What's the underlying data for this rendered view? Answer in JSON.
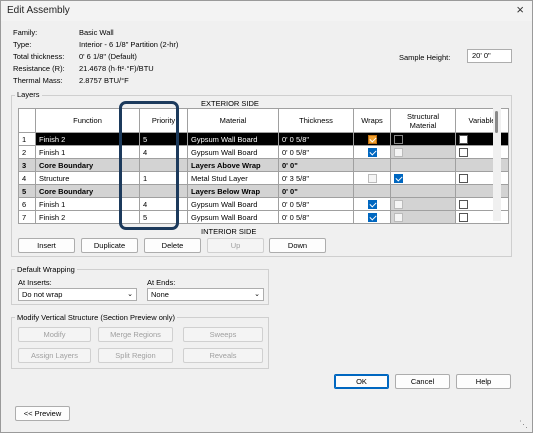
{
  "window": {
    "title": "Edit Assembly",
    "close_icon": "×"
  },
  "info": {
    "family_label": "Family:",
    "family_value": "Basic Wall",
    "type_label": "Type:",
    "type_value": "Interior - 6 1/8\" Partition (2-hr)",
    "thickness_label": "Total thickness:",
    "thickness_value": "0'  6 1/8\" (Default)",
    "resistance_label": "Resistance (R):",
    "resistance_value": "21.4678 (h·ft²·°F)/BTU",
    "mass_label": "Thermal Mass:",
    "mass_value": "2.8757 BTU/°F",
    "sample_height_label": "Sample Height:",
    "sample_height_value": "20'  0\""
  },
  "layers": {
    "group_title": "Layers",
    "exterior_label": "EXTERIOR SIDE",
    "interior_label": "INTERIOR SIDE",
    "columns": [
      "",
      "Function",
      "Priority",
      "Material",
      "Thickness",
      "Wraps",
      "Structural Material",
      "Variable"
    ],
    "rows": [
      {
        "num": "1",
        "function": "Finish 2",
        "priority": "5",
        "material": "Gypsum Wall Board",
        "thickness": "0'  0 5/8\""
      },
      {
        "num": "2",
        "function": "Finish 1",
        "priority": "4",
        "material": "Gypsum Wall Board",
        "thickness": "0'  0 5/8\""
      },
      {
        "num": "3",
        "function": "Core Boundary",
        "priority": "",
        "material": "Layers Above Wrap",
        "thickness": "0'  0\""
      },
      {
        "num": "4",
        "function": "Structure",
        "priority": "1",
        "material": "Metal Stud Layer",
        "thickness": "0'  3 5/8\""
      },
      {
        "num": "5",
        "function": "Core Boundary",
        "priority": "",
        "material": "Layers Below Wrap",
        "thickness": "0'  0\""
      },
      {
        "num": "6",
        "function": "Finish 1",
        "priority": "4",
        "material": "Gypsum Wall Board",
        "thickness": "0'  0 5/8\""
      },
      {
        "num": "7",
        "function": "Finish 2",
        "priority": "5",
        "material": "Gypsum Wall Board",
        "thickness": "0'  0 5/8\""
      }
    ]
  },
  "layer_buttons": {
    "insert": "Insert",
    "duplicate": "Duplicate",
    "delete": "Delete",
    "up": "Up",
    "down": "Down"
  },
  "wrapping": {
    "group_title": "Default Wrapping",
    "inserts_label": "At Inserts:",
    "inserts_value": "Do not wrap",
    "ends_label": "At Ends:",
    "ends_value": "None"
  },
  "vertical": {
    "group_title": "Modify Vertical Structure (Section Preview only)",
    "modify": "Modify",
    "merge": "Merge Regions",
    "sweeps": "Sweeps",
    "assign": "Assign Layers",
    "split": "Split Region",
    "reveals": "Reveals"
  },
  "footer": {
    "ok": "OK",
    "cancel": "Cancel",
    "help": "Help",
    "preview": "<< Preview"
  },
  "colors": {
    "highlight": "#1c3a5c",
    "selected_row": "#000000",
    "core_row": "#d3d3d3",
    "accent": "#0067c0"
  }
}
